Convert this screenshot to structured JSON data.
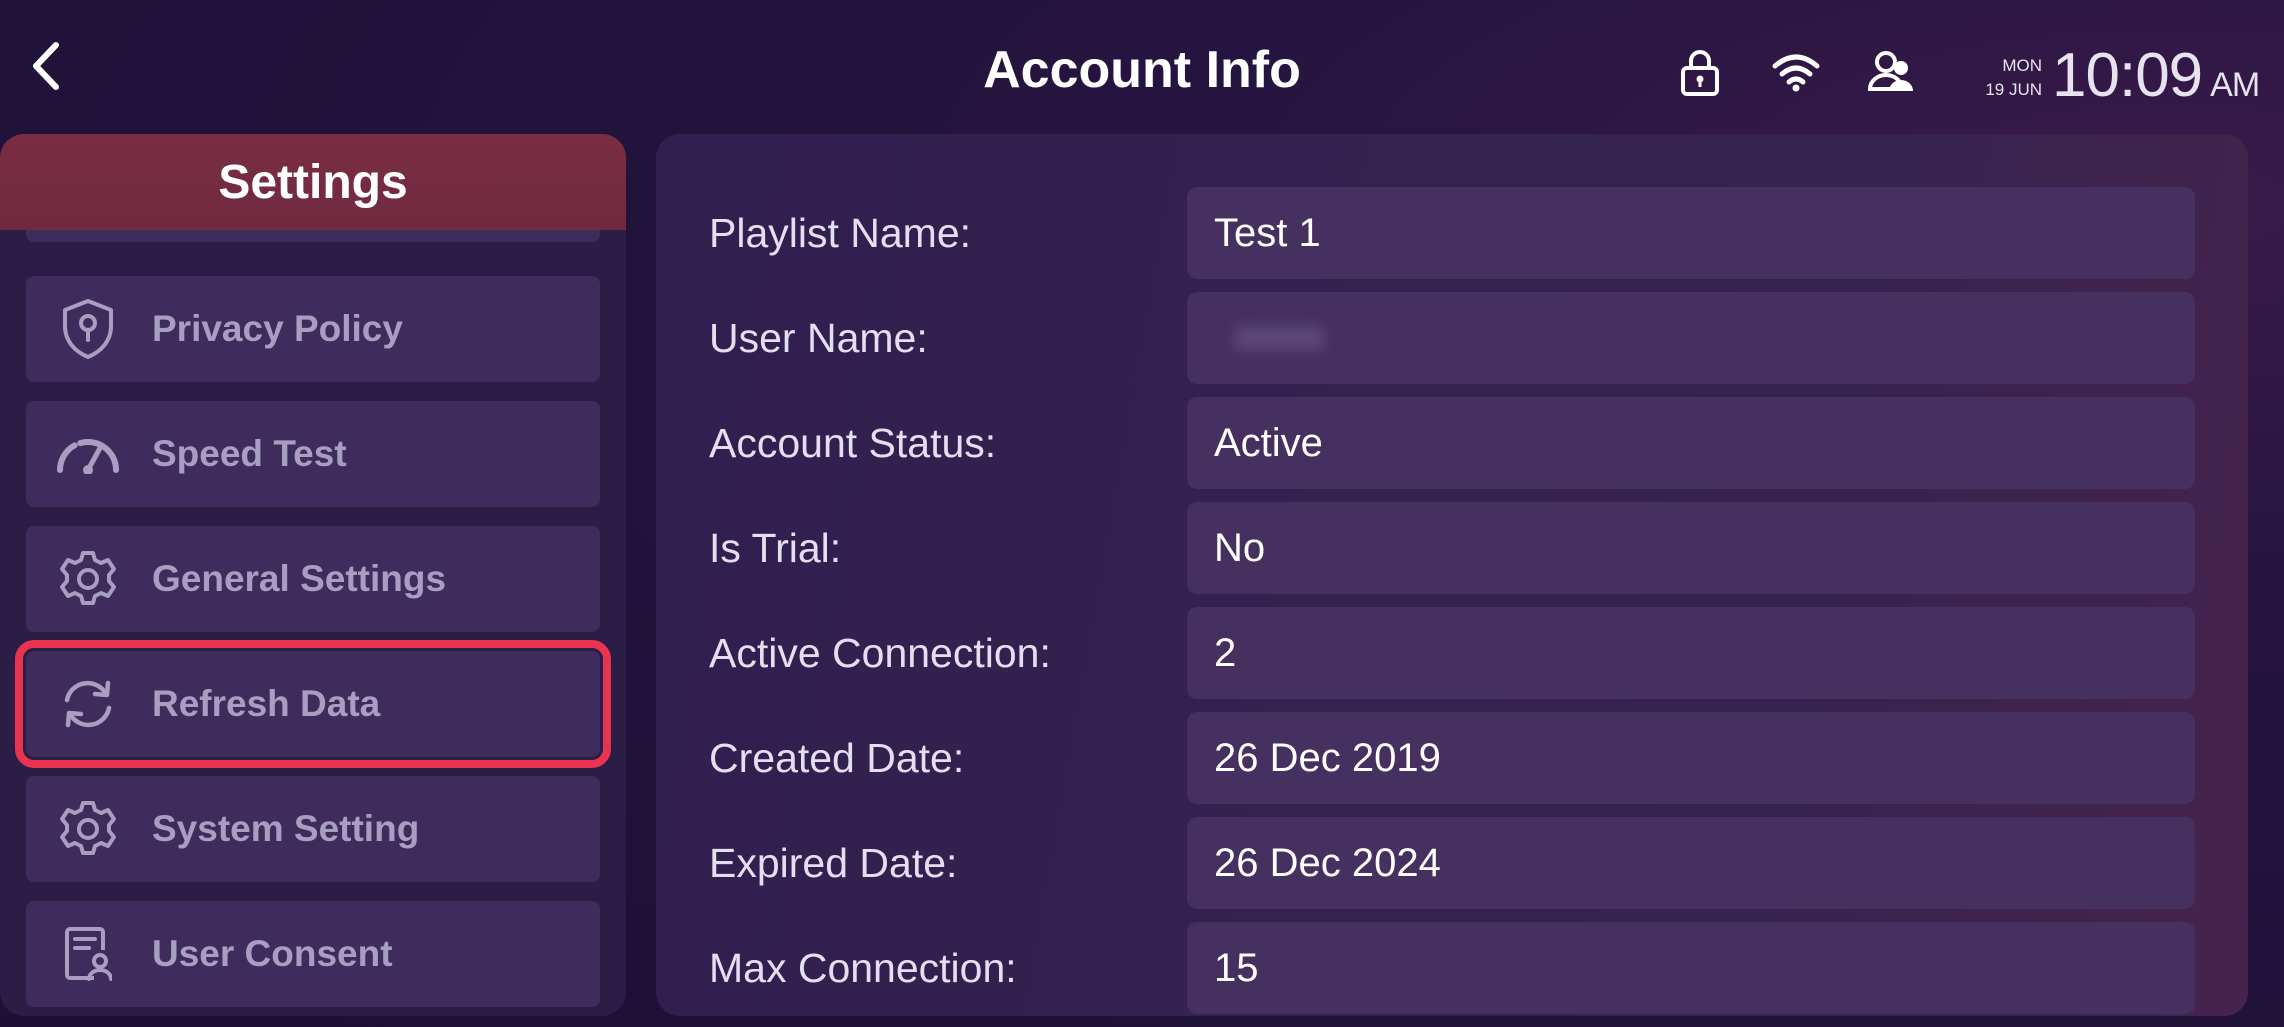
{
  "header": {
    "title": "Account Info",
    "back_icon": "chevron-left-icon",
    "status_icons": [
      "lock-icon",
      "wifi-icon",
      "users-icon"
    ],
    "date_day": "MON",
    "date_date": "19 JUN",
    "time": "10:09",
    "ampm": "AM"
  },
  "sidebar": {
    "title": "Settings",
    "items": [
      {
        "label": "Privacy Policy",
        "icon": "shield-icon"
      },
      {
        "label": "Speed Test",
        "icon": "speedometer-icon"
      },
      {
        "label": "General Settings",
        "icon": "gear-icon"
      },
      {
        "label": "Refresh Data",
        "icon": "refresh-icon",
        "selected": true
      },
      {
        "label": "System Setting",
        "icon": "gear-icon"
      },
      {
        "label": "User Consent",
        "icon": "document-user-icon"
      }
    ]
  },
  "account": {
    "rows": [
      {
        "label": "Playlist Name:",
        "value": "Test 1"
      },
      {
        "label": "User Name:",
        "value": ""
      },
      {
        "label": "Account Status:",
        "value": "Active"
      },
      {
        "label": "Is Trial:",
        "value": "No"
      },
      {
        "label": "Active Connection:",
        "value": "2"
      },
      {
        "label": "Created Date:",
        "value": "26 Dec 2019"
      },
      {
        "label": "Expired Date:",
        "value": "26 Dec 2024"
      },
      {
        "label": "Max Connection:",
        "value": "15"
      }
    ]
  },
  "colors": {
    "background": "#1e1236",
    "sidebar_header": "#7a2d43",
    "selection_outline": "#e8344e",
    "field_background": "#45305f"
  }
}
